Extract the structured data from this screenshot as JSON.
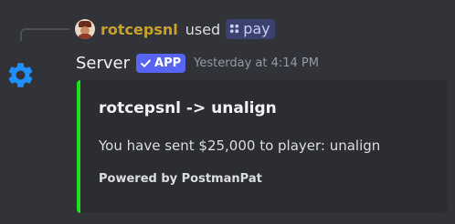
{
  "reply": {
    "username": "rotcepsnl",
    "action_text": "used",
    "command_name": "pay",
    "username_color": "#c9a227",
    "avatar_icon": "user-avatar-icon",
    "command_icon": "slash-command-icon"
  },
  "message": {
    "author": "Server",
    "badge_label": "APP",
    "badge_icon": "checkmark-icon",
    "timestamp": "Yesterday at 4:14 PM",
    "avatar_icon": "gear-icon",
    "avatar_color": "#1e90ff"
  },
  "embed": {
    "accent_color": "#1be41b",
    "title": "rotcepsnl -> unalign",
    "description": "You have sent $25,000 to player: unalign",
    "footer": "Powered by PostmanPat"
  }
}
